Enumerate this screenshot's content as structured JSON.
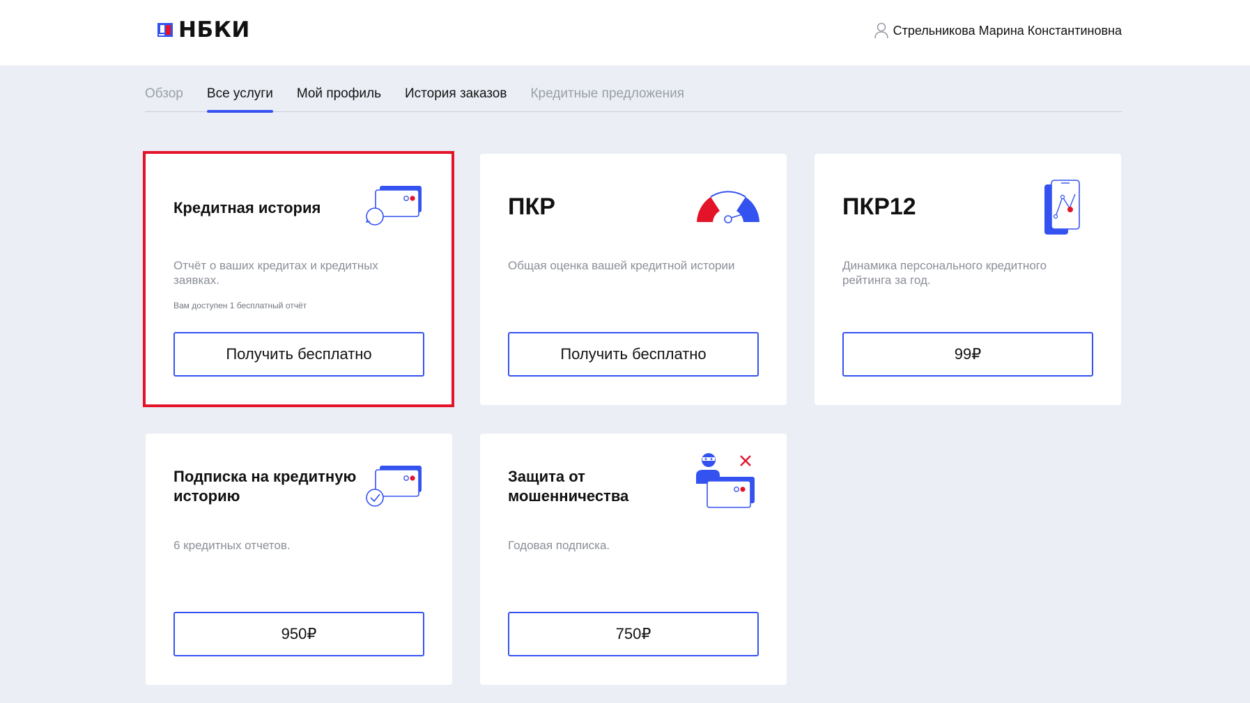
{
  "header": {
    "logo_text": "НБКИ",
    "user_name": "Стрельникова Марина Константиновна"
  },
  "tabs": [
    {
      "label": "Обзор",
      "state": "muted"
    },
    {
      "label": "Все услуги",
      "state": "active"
    },
    {
      "label": "Мой профиль",
      "state": "normal"
    },
    {
      "label": "История заказов",
      "state": "normal"
    },
    {
      "label": "Кредитные предложения",
      "state": "muted"
    }
  ],
  "cards": [
    {
      "title": "Кредитная история",
      "description": "Отчёт о ваших кредитах и кредитных заявках.",
      "note": "Вам доступен 1 бесплатный отчёт",
      "button": "Получить бесплатно",
      "icon": "credit-cards-refresh-icon"
    },
    {
      "title": "ПКР",
      "description": "Общая оценка вашей кредитной истории",
      "button": "Получить бесплатно",
      "icon": "gauge-icon"
    },
    {
      "title": "ПКР12",
      "description": "Динамика персонального кредитного рейтинга за год.",
      "button": "99₽",
      "icon": "phone-chart-icon"
    },
    {
      "title": "Подписка на кредитную историю",
      "description": "6 кредитных отчетов.",
      "button": "950₽",
      "icon": "credit-cards-check-icon"
    },
    {
      "title": "Защита от мошенничества",
      "description": "Годовая подписка.",
      "button": "750₽",
      "icon": "thief-card-icon"
    }
  ],
  "colors": {
    "accent": "#3452f0",
    "brand_red": "#e3142a",
    "background": "#ebeef5"
  }
}
